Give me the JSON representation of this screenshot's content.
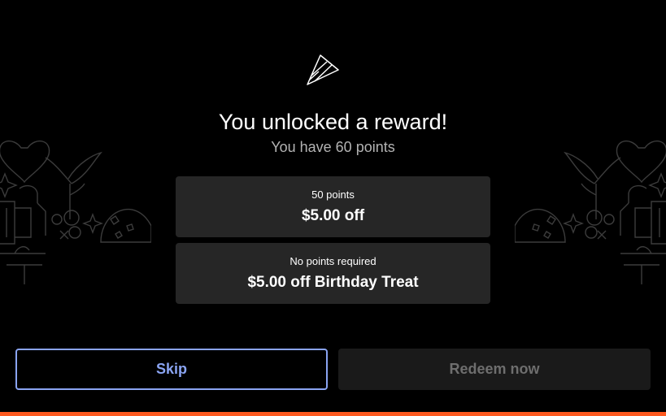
{
  "header": {
    "icon": "party-hat-icon",
    "title": "You unlocked a reward!",
    "subtitle": "You have 60 points"
  },
  "rewards": [
    {
      "caption": "50 points",
      "value": "$5.00 off"
    },
    {
      "caption": "No points required",
      "value": "$5.00 off Birthday Treat"
    }
  ],
  "actions": {
    "skip_label": "Skip",
    "redeem_label": "Redeem now"
  },
  "colors": {
    "background": "#000000",
    "card": "#262626",
    "accent": "#8aa4f2",
    "disabled_text": "#6e6e6e",
    "brand_bar": "#ff5a1f"
  }
}
